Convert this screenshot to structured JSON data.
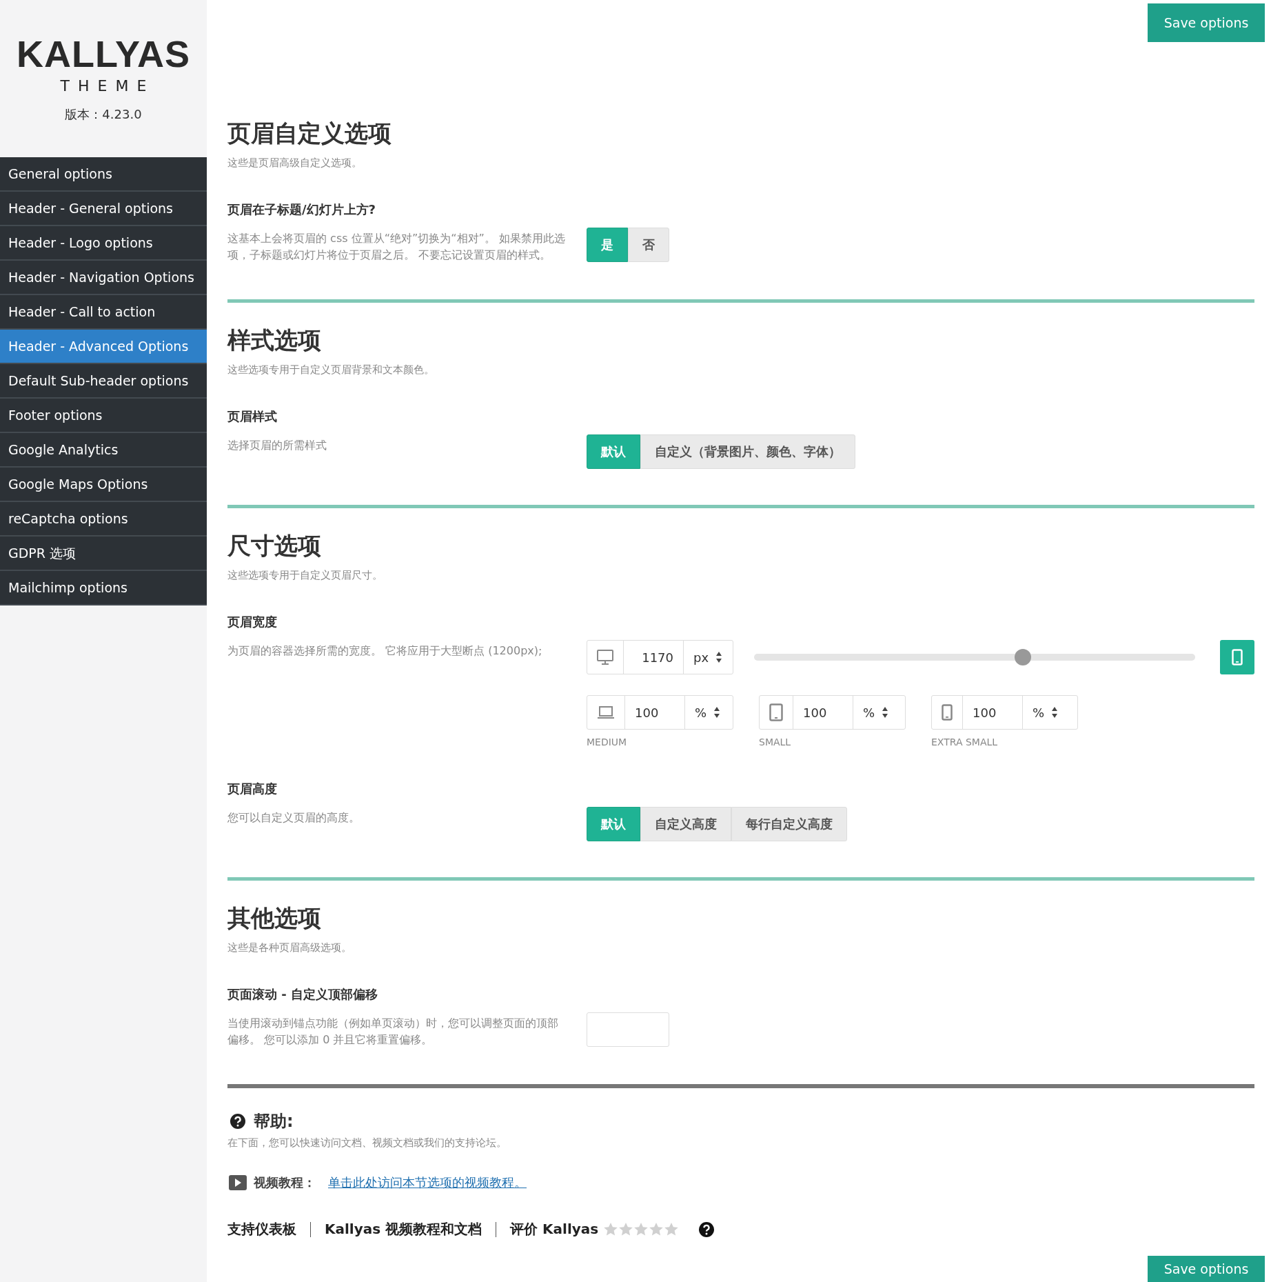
{
  "sidebar": {
    "logo": {
      "name": "KALLYAS",
      "tagline": "THEME"
    },
    "version": "版本：4.23.0",
    "items": [
      {
        "label": "General options",
        "selected": false
      },
      {
        "label": "Header - General options",
        "selected": false
      },
      {
        "label": "Header - Logo options",
        "selected": false
      },
      {
        "label": "Header - Navigation Options",
        "selected": false
      },
      {
        "label": "Header - Call to action",
        "selected": false
      },
      {
        "label": "Header - Advanced Options",
        "selected": true
      },
      {
        "label": "Default Sub-header options",
        "selected": false
      },
      {
        "label": "Footer options",
        "selected": false
      },
      {
        "label": "Google Analytics",
        "selected": false
      },
      {
        "label": "Google Maps Options",
        "selected": false
      },
      {
        "label": "reCaptcha options",
        "selected": false
      },
      {
        "label": "GDPR 选项",
        "selected": false
      },
      {
        "label": "Mailchimp options",
        "selected": false
      }
    ]
  },
  "save_button": "Save options",
  "sections": [
    {
      "title": "页眉自定义选项",
      "description": "这些是页眉高级自定义选项。",
      "options": [
        {
          "kind": "toggle",
          "label": "页眉在子标题/幻灯片上方?",
          "description": "这基本上会将页眉的 css 位置从“绝对”切换为“相对”。 如果禁用此选项，子标题或幻灯片将位于页眉之后。 不要忘记设置页眉的样式。",
          "buttons": [
            {
              "label": "是",
              "selected": true
            },
            {
              "label": "否",
              "selected": false
            }
          ]
        }
      ]
    },
    {
      "title": "样式选项",
      "description": "这些选项专用于自定义页眉背景和文本颜色。",
      "options": [
        {
          "kind": "toggle",
          "label": "页眉样式",
          "description": "选择页眉的所需样式",
          "buttons": [
            {
              "label": "默认",
              "selected": true
            },
            {
              "label": "自定义（背景图片、颜色、字体）",
              "selected": false
            }
          ]
        }
      ]
    },
    {
      "title": "尺寸选项",
      "description": "这些选项专用于自定义页眉尺寸。",
      "options": [
        {
          "kind": "dimension",
          "label": "页眉宽度",
          "description": "为页眉的容器选择所需的宽度。 它将应用于大型断点 (1200px);",
          "value": "1170",
          "unit": "px",
          "level": 0.61,
          "breakpoints": [
            {
              "label": "MEDIUM",
              "value": "100",
              "unit": "%"
            },
            {
              "label": "SMALL",
              "value": "100",
              "unit": "%"
            },
            {
              "label": "EXTRA SMALL",
              "value": "100",
              "unit": "%"
            }
          ]
        },
        {
          "kind": "toggle",
          "label": "页眉高度",
          "description": "您可以自定义页眉的高度。",
          "buttons": [
            {
              "label": "默认",
              "selected": true
            },
            {
              "label": "自定义高度",
              "selected": false
            },
            {
              "label": "每行自定义高度",
              "selected": false
            }
          ]
        }
      ]
    },
    {
      "title": "其他选项",
      "description": "这些是各种页眉高级选项。",
      "options": [
        {
          "kind": "text",
          "label": "页面滚动 - 自定义顶部偏移",
          "description": "当使用滚动到锚点功能（例如单页滚动）时，您可以调整页面的顶部偏移。 您可以添加 0 并且它将重置偏移。"
        }
      ]
    }
  ],
  "help": {
    "title": "帮助:",
    "description": "在下面，您可以快速访问文档、视频文档或我们的支持论坛。",
    "video_label": "视频教程：",
    "video_link": "单击此处访问本节选项的视频教程。"
  },
  "footer_links": [
    "支持仪表板",
    "Kallyas 视频教程和文档"
  ],
  "rating": {
    "label": "评价 Kallyas",
    "stars": 0
  },
  "bottom_save_button": "Save options"
}
